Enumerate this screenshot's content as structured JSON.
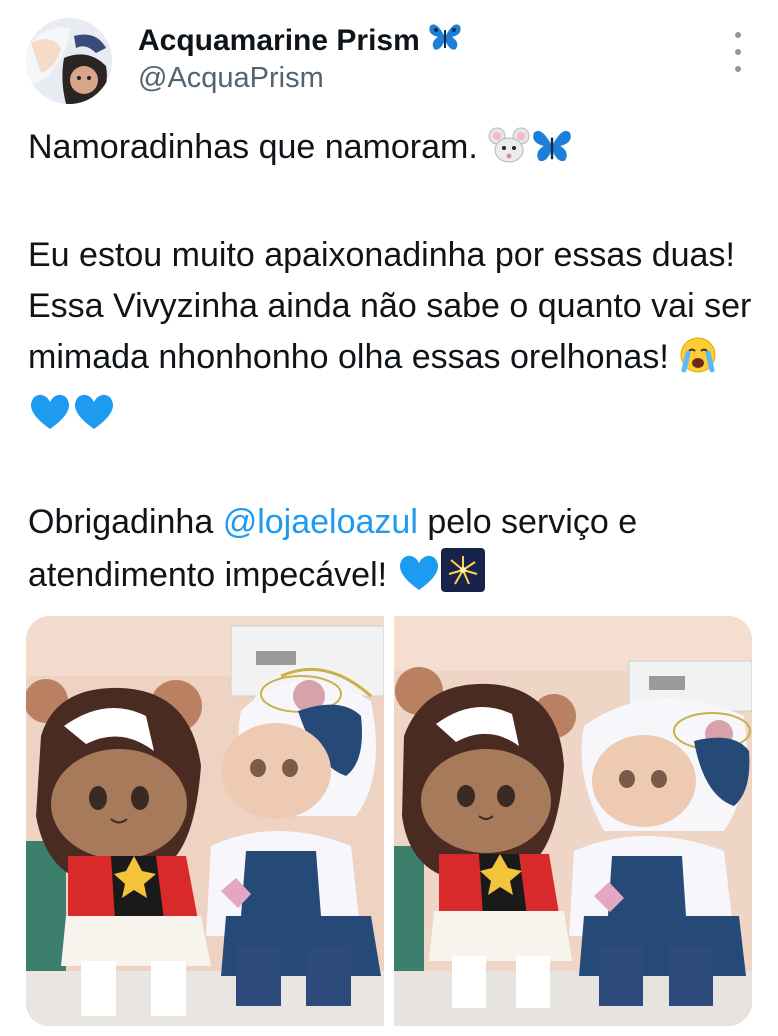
{
  "author": {
    "display_name": "Acquamarine Prism",
    "name_emoji": "butterfly-emoji",
    "handle": "@AcquaPrism",
    "avatar": "avatar-image"
  },
  "tweet": {
    "line1": "Namoradinhas que namoram. ",
    "para2": "Eu estou muito apaixonadinha por essas duas! Essa Vivyzinha ainda não sabe o quanto vai ser mimada nhonhonho olha essas orelhonas! ",
    "para3_before": "Obrigadinha ",
    "mention": "@lojaeloazul",
    "para3_after": " pelo serviço e atendimento impecável! "
  },
  "media": {
    "photos": [
      {
        "name": "photo-1",
        "description": "plush dolls photo"
      },
      {
        "name": "photo-2",
        "description": "plush dolls photo"
      }
    ]
  },
  "colors": {
    "text": "#0f1419",
    "secondary": "#536471",
    "link": "#1d9bf0",
    "heart": "#1d9bf0"
  }
}
